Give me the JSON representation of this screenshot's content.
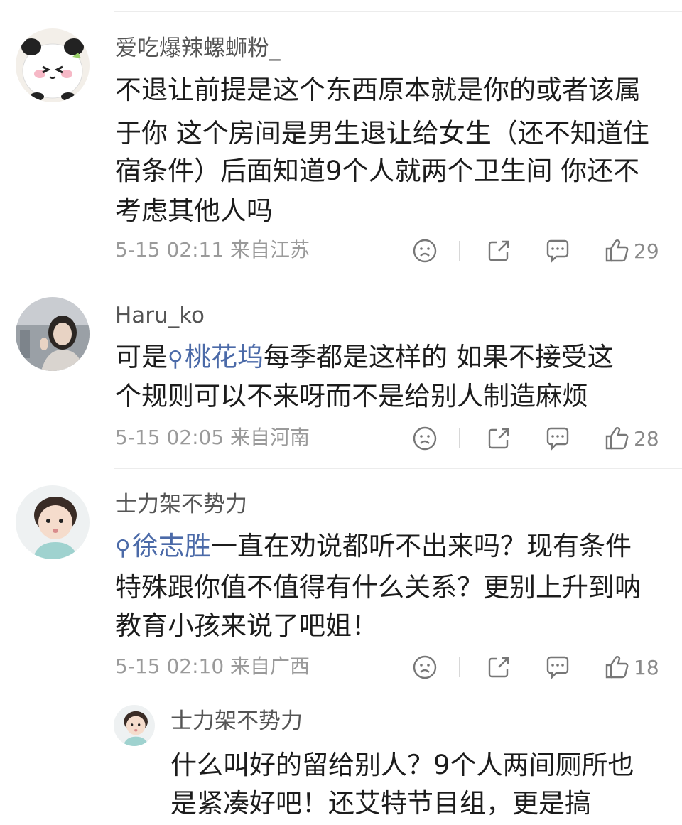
{
  "comments": [
    {
      "username": "爱吃爆辣螺蛳粉_",
      "lines": [
        "不退让前提是这个东西原本就是你的或者该属",
        "于你 这个房间是男生退让给女生（还不知道住",
        "宿条件）后面知道9个人就两个卫生间 你还不",
        "考虑其他人吗"
      ],
      "time": "5-15 02:11",
      "location": "来自江苏",
      "likes": "29"
    },
    {
      "username": "Haru_ko",
      "line1_prefix": "可是",
      "mention": "桃花坞",
      "line1_suffix": "每季都是这样的 如果不接受这",
      "line2": "个规则可以不来呀而不是给别人制造麻烦",
      "time": "5-15 02:05",
      "location": "来自河南",
      "likes": "28"
    },
    {
      "username": "士力架不势力",
      "mention": "徐志胜",
      "line1_suffix": "一直在劝说都听不出来吗？现有条件",
      "line2": "特殊跟你值不值得有什么关系？更别上升到呐",
      "line3": "教育小孩来说了吧姐！",
      "time": "5-15 02:10",
      "location": "来自广西",
      "likes": "18"
    }
  ],
  "reply": {
    "username": "士力架不势力",
    "lines": [
      "什么叫好的留给别人？9个人两间厕所也",
      "是紧凑好吧！还艾特节目组，更是搞"
    ]
  },
  "icons": {
    "mention": "search-icon",
    "dislike": "sad-face-icon",
    "share": "share-icon",
    "comment": "comment-icon",
    "like": "thumbs-up-icon"
  },
  "colors": {
    "mention": "#4b6aa8",
    "meta": "#9a9a9a",
    "username": "#555555"
  }
}
